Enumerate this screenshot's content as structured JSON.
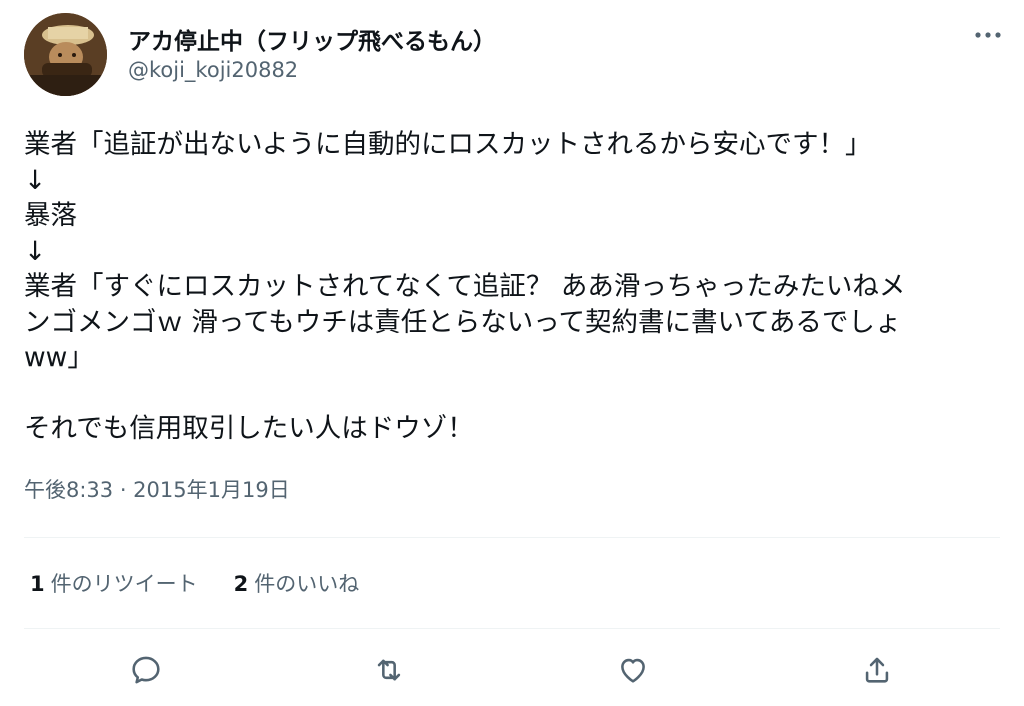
{
  "author": {
    "display_name": "アカ停止中（フリップ飛べるもん）",
    "handle": "@koji_koji20882",
    "avatar_icon": "avatar-photo"
  },
  "tweet": {
    "lines": [
      "業者「追証が出ないように自動的にロスカットされるから安心です！」",
      "↓",
      "暴落",
      "↓",
      "業者「すぐにロスカットされてなくて追証？ ああ滑っちゃったみたいねメ",
      "ンゴメンゴｗ 滑ってもウチは責任とらないって契約書に書いてあるでしょ",
      "ww」",
      "",
      "それでも信用取引したい人はドウゾ！"
    ]
  },
  "timestamp": "午後8:33 · 2015年1月19日",
  "stats": {
    "retweets": {
      "count": "1",
      "label": "件のリツイート"
    },
    "likes": {
      "count": "2",
      "label": "件のいいね"
    }
  },
  "actions": {
    "reply_icon": "reply-icon",
    "retweet_icon": "retweet-icon",
    "like_icon": "heart-icon",
    "share_icon": "share-icon",
    "more_icon": "more-icon"
  },
  "colors": {
    "text_primary": "#0f1419",
    "text_secondary": "#536471",
    "divider": "#eff3f4"
  }
}
